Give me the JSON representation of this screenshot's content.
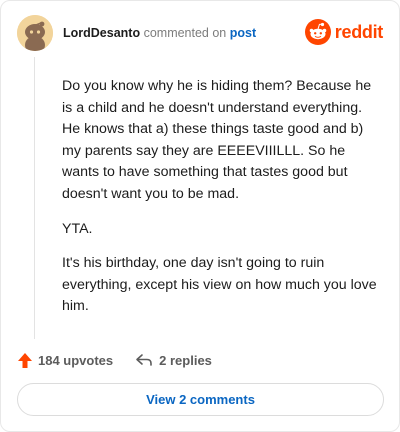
{
  "header": {
    "author": "LordDesanto",
    "action_text": "commented on",
    "link_text": "post",
    "brand_name": "reddit"
  },
  "comment": {
    "paragraphs": [
      "Do you know why he is hiding them? Because he is a child and he doesn't understand everything. He knows that a) these things taste good and b) my parents say they are EEEEVIIILLL. So he wants to have something that tastes good but doesn't want you to be mad.",
      "YTA.",
      "It's his birthday, one day isn't going to ruin everything, except his view on how much you love him."
    ]
  },
  "footer": {
    "upvotes_label": "184 upvotes",
    "replies_label": "2 replies",
    "view_comments_label": "View 2 comments"
  },
  "icons": {
    "upvote": "upvote-arrow-icon",
    "reply": "reply-arrow-icon",
    "brand": "reddit-snoo-icon",
    "avatar": "snoo-avatar"
  },
  "colors": {
    "brand": "#ff4500",
    "link": "#0a66c2",
    "upvote": "#ff4500",
    "muted": "#7c7c7c"
  }
}
